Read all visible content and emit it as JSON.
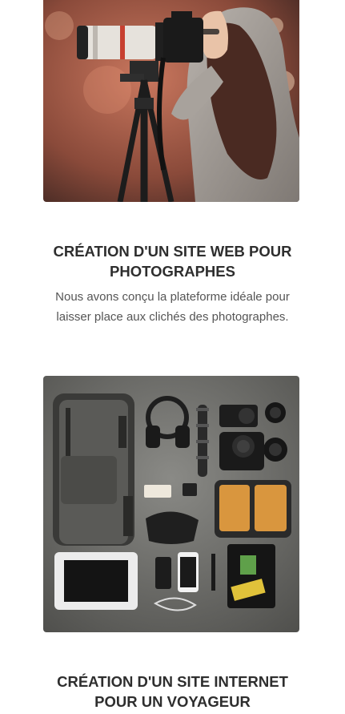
{
  "cards": [
    {
      "image": "photographer-with-camera-on-tripod",
      "title_line1": "CRÉATION D'UN SITE WEB POUR",
      "title_line2": "PHOTOGRAPHES",
      "description_line1": "Nous avons conçu la plateforme idéale pour",
      "description_line2": "laisser place aux clichés des photographes."
    },
    {
      "image": "travel-gear-flatlay",
      "title_line1": "CRÉATION D'UN SITE INTERNET",
      "title_line2": "POUR UN VOYAGEUR"
    }
  ]
}
